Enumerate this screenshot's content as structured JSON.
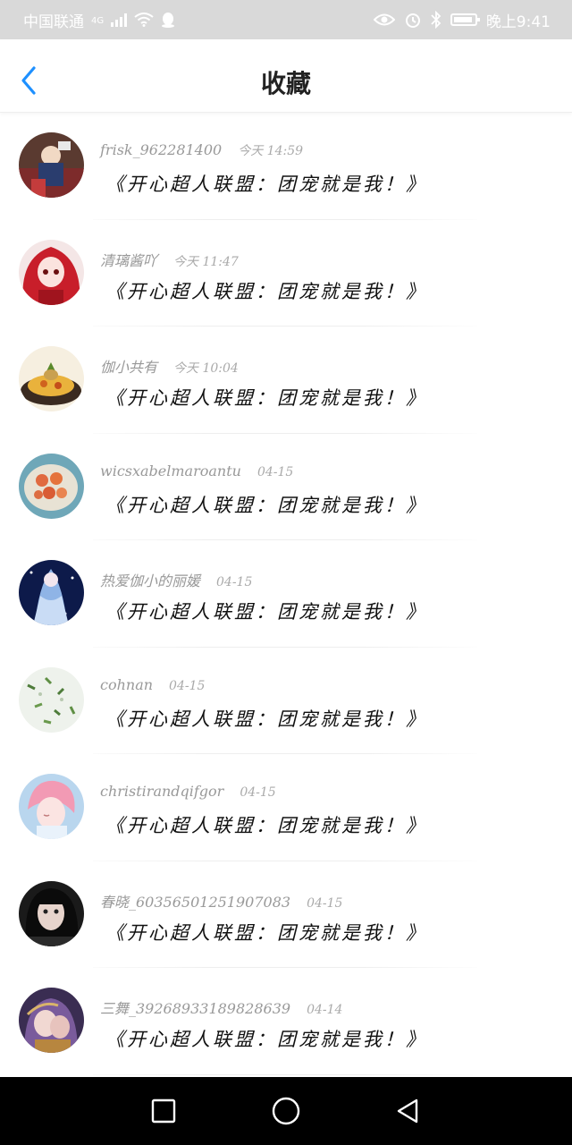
{
  "status_bar": {
    "carrier": "中国联通",
    "network": "4G",
    "time": "晚上9:41"
  },
  "header": {
    "title": "收藏"
  },
  "items": [
    {
      "user": "frisk_962281400",
      "time": "今天 14:59",
      "title": "《开心超人联盟：团宠就是我！》"
    },
    {
      "user": "清璃酱吖",
      "time": "今天 11:47",
      "title": "《开心超人联盟：团宠就是我！》"
    },
    {
      "user": "伽小共有",
      "time": "今天 10:04",
      "title": "《开心超人联盟：团宠就是我！》"
    },
    {
      "user": "wicsxabelmaroantu",
      "time": "04-15",
      "title": "《开心超人联盟：团宠就是我！》"
    },
    {
      "user": "热爱伽小的丽媛",
      "time": "04-15",
      "title": "《开心超人联盟：团宠就是我！》"
    },
    {
      "user": "cohnan",
      "time": "04-15",
      "title": "《开心超人联盟：团宠就是我！》"
    },
    {
      "user": "christirandqifgor",
      "time": "04-15",
      "title": "《开心超人联盟：团宠就是我！》"
    },
    {
      "user": "春晓_60356501251907083",
      "time": "04-15",
      "title": "《开心超人联盟：团宠就是我！》"
    },
    {
      "user": "三舞_39268933189828639",
      "time": "04-14",
      "title": "《开心超人联盟：团宠就是我！》"
    }
  ],
  "colors": {
    "accent": "#1e90ff",
    "meta_text": "#999999",
    "status_bar_bg": "#d9d9d9",
    "nav_bar_bg": "#000000"
  }
}
